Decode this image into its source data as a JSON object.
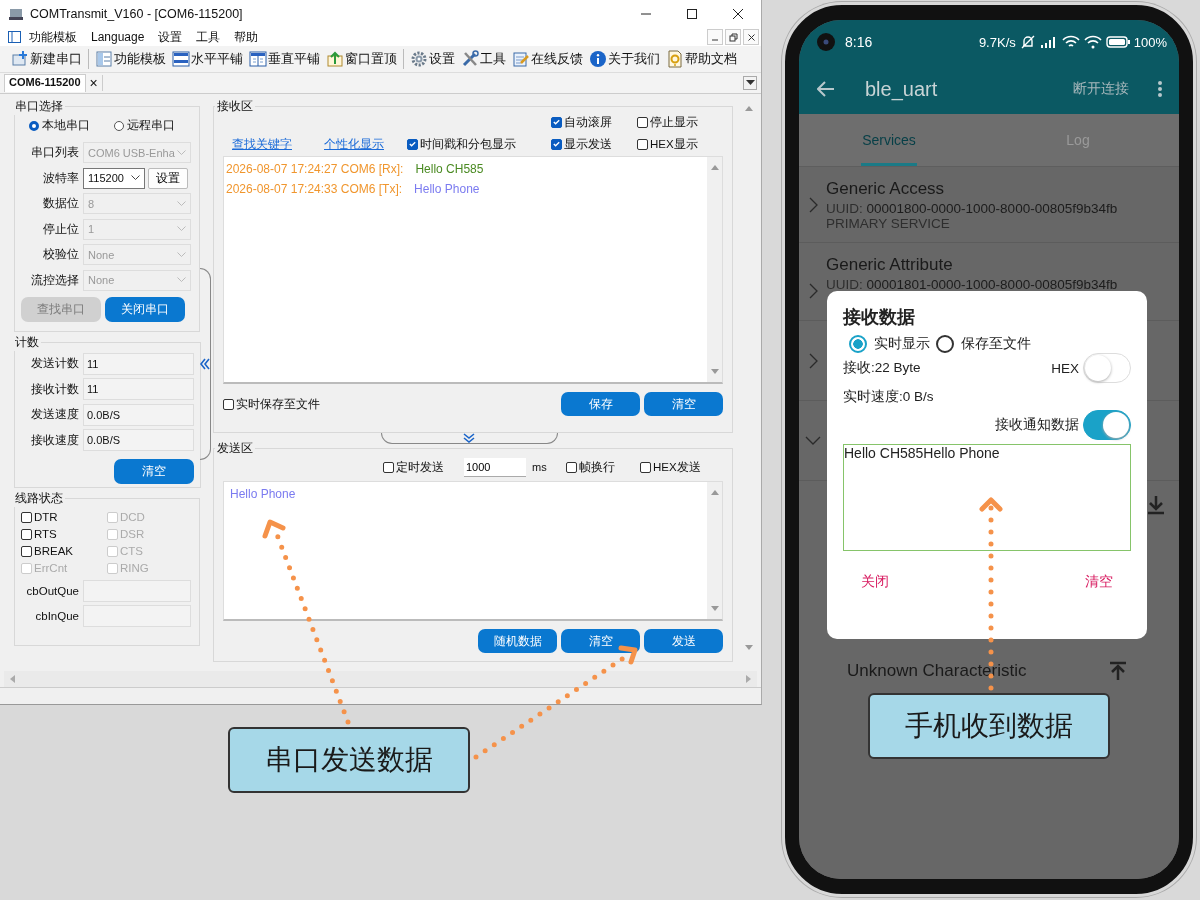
{
  "window": {
    "title": "COMTransmit_V160 - [COM6-115200]"
  },
  "menu": [
    "功能模板",
    "Language",
    "设置",
    "工具",
    "帮助"
  ],
  "toolbar": [
    [
      {
        "label": "新建串口",
        "kind": "new"
      }
    ],
    [
      {
        "label": "功能模板",
        "kind": "template"
      },
      {
        "label": "水平平铺",
        "kind": "htile"
      },
      {
        "label": "垂直平铺",
        "kind": "vtile"
      },
      {
        "label": "窗口置顶",
        "kind": "top"
      }
    ],
    [
      {
        "label": "设置",
        "kind": "settings"
      },
      {
        "label": "工具",
        "kind": "tools"
      },
      {
        "label": "在线反馈",
        "kind": "feedback"
      },
      {
        "label": "关于我们",
        "kind": "about"
      },
      {
        "label": "帮助文档",
        "kind": "help"
      }
    ]
  ],
  "doc_tab": {
    "label": "COM6-115200",
    "close": "×"
  },
  "port_group": {
    "title": "串口选择",
    "modes": [
      {
        "label": "本地串口",
        "selected": true
      },
      {
        "label": "远程串口",
        "selected": false
      }
    ],
    "fields": [
      {
        "label": "串口列表",
        "value": "COM6   USB-Enha",
        "disabled": true
      },
      {
        "label": "波特率",
        "value": "115200",
        "disabled": false,
        "button": "设置"
      },
      {
        "label": "数据位",
        "value": "8",
        "disabled": true
      },
      {
        "label": "停止位",
        "value": "1",
        "disabled": true
      },
      {
        "label": "校验位",
        "value": "None",
        "disabled": true
      },
      {
        "label": "流控选择",
        "value": "None",
        "disabled": true
      }
    ],
    "buttons": [
      {
        "label": "查找串口",
        "disabled": true
      },
      {
        "label": "关闭串口",
        "disabled": false
      }
    ]
  },
  "count_group": {
    "title": "计数",
    "rows": [
      {
        "label": "发送计数",
        "value": "11"
      },
      {
        "label": "接收计数",
        "value": "11"
      },
      {
        "label": "发送速度",
        "value": "0.0B/S"
      },
      {
        "label": "接收速度",
        "value": "0.0B/S"
      }
    ],
    "button": "清空"
  },
  "line_group": {
    "title": "线路状态",
    "checks": [
      {
        "label": "DTR",
        "checked": false,
        "disabled": false
      },
      {
        "label": "DCD",
        "checked": false,
        "disabled": true
      },
      {
        "label": "RTS",
        "checked": false,
        "disabled": false
      },
      {
        "label": "DSR",
        "checked": false,
        "disabled": true
      },
      {
        "label": "BREAK",
        "checked": false,
        "disabled": false
      },
      {
        "label": "CTS",
        "checked": false,
        "disabled": true
      },
      {
        "label": "ErrCnt",
        "checked": false,
        "disabled": true
      },
      {
        "label": "RING",
        "checked": false,
        "disabled": true
      }
    ],
    "queues": [
      "cbOutQue",
      "cbInQue"
    ]
  },
  "receive": {
    "title": "接收区",
    "links": [
      "查找关键字",
      "个性化显示"
    ],
    "top_options": [
      {
        "label": "自动滚屏",
        "checked": true
      },
      {
        "label": "停止显示",
        "checked": false
      }
    ],
    "timestamp": {
      "label": "时间戳和分包显示",
      "checked": true
    },
    "options": [
      {
        "label": "显示发送",
        "checked": true
      },
      {
        "label": "HEX显示",
        "checked": false
      }
    ],
    "log": [
      {
        "stamp": "2026-08-07 17:24:27 COM6 [Rx]:",
        "text": "Hello CH585",
        "kind": "rx"
      },
      {
        "stamp": "2026-08-07 17:24:33 COM6 [Tx]:",
        "text": "Hello Phone",
        "kind": "tx"
      }
    ],
    "save_to_file": {
      "label": "实时保存至文件",
      "checked": false
    },
    "buttons": [
      "保存",
      "清空"
    ]
  },
  "send": {
    "title": "发送区",
    "timed": {
      "label": "定时发送",
      "checked": false
    },
    "interval": "1000",
    "unit": "ms",
    "options": [
      {
        "label": "帧换行",
        "checked": false
      },
      {
        "label": "HEX发送",
        "checked": false
      }
    ],
    "text": "Hello Phone",
    "buttons": [
      "随机数据",
      "清空",
      "发送"
    ]
  },
  "phone": {
    "status": {
      "time": "8:16",
      "speed": "9.7K/s",
      "battery": "100%"
    },
    "appbar": {
      "title": "ble_uart",
      "action": "断开连接"
    },
    "tabs": [
      {
        "label": "Services",
        "selected": true
      },
      {
        "label": "Log",
        "selected": false
      }
    ],
    "services": [
      {
        "name": "Generic Access",
        "uuid_label": "UUID:",
        "uuid": "00001800-0000-1000-8000-00805f9b34fb",
        "type": "PRIMARY SERVICE"
      },
      {
        "name": "Generic Attribute",
        "uuid_label": "UUID:",
        "uuid": "00001801-0000-1000-8000-00805f9b34fb"
      }
    ],
    "characteristic": "Unknown Characteristic",
    "dialog": {
      "title": "接收数据",
      "modes": [
        {
          "label": "实时显示",
          "selected": true
        },
        {
          "label": "保存至文件",
          "selected": false
        }
      ],
      "received": "接收:22 Byte",
      "hex": {
        "label": "HEX",
        "on": false
      },
      "speed": "实时速度:0 B/s",
      "notify": {
        "label": "接收通知数据",
        "on": true
      },
      "content": "Hello CH585Hello Phone",
      "buttons": [
        "关闭",
        "清空"
      ]
    }
  },
  "callouts": [
    "串口发送数据",
    "手机收到数据"
  ]
}
